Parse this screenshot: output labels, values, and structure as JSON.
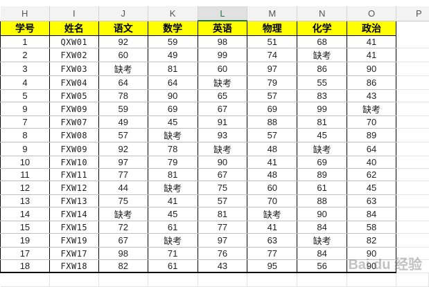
{
  "column_letters": [
    "H",
    "I",
    "J",
    "K",
    "L",
    "M",
    "N",
    "O",
    "P"
  ],
  "selected_column": "L",
  "headers": [
    "学号",
    "姓名",
    "语文",
    "数学",
    "英语",
    "物理",
    "化学",
    "政治"
  ],
  "rows": [
    [
      "1",
      "QXW01",
      "92",
      "59",
      "98",
      "51",
      "68",
      "41"
    ],
    [
      "2",
      "FXW02",
      "60",
      "49",
      "99",
      "74",
      "缺考",
      "41"
    ],
    [
      "3",
      "FXW03",
      "缺考",
      "81",
      "60",
      "97",
      "86",
      "90"
    ],
    [
      "4",
      "FXW04",
      "64",
      "64",
      "缺考",
      "79",
      "55",
      "86"
    ],
    [
      "5",
      "FXW05",
      "78",
      "90",
      "65",
      "57",
      "83",
      "43"
    ],
    [
      "9",
      "FXW09",
      "59",
      "69",
      "67",
      "69",
      "99",
      "缺考"
    ],
    [
      "7",
      "FXW07",
      "49",
      "45",
      "91",
      "88",
      "81",
      "70"
    ],
    [
      "8",
      "FXW08",
      "57",
      "缺考",
      "93",
      "57",
      "45",
      "89"
    ],
    [
      "9",
      "FXW09",
      "92",
      "78",
      "缺考",
      "48",
      "缺考",
      "64"
    ],
    [
      "10",
      "FXW10",
      "97",
      "79",
      "90",
      "41",
      "69",
      "40"
    ],
    [
      "11",
      "FXW11",
      "77",
      "81",
      "67",
      "48",
      "89",
      "62"
    ],
    [
      "12",
      "FXW12",
      "44",
      "缺考",
      "75",
      "60",
      "61",
      "45"
    ],
    [
      "13",
      "FXW13",
      "75",
      "41",
      "57",
      "70",
      "88",
      "63"
    ],
    [
      "14",
      "FXW14",
      "缺考",
      "45",
      "81",
      "缺考",
      "90",
      "84"
    ],
    [
      "15",
      "FXW15",
      "72",
      "61",
      "77",
      "41",
      "84",
      "58"
    ],
    [
      "19",
      "FXW19",
      "67",
      "缺考",
      "97",
      "63",
      "缺考",
      "82"
    ],
    [
      "17",
      "FXW17",
      "98",
      "71",
      "76",
      "77",
      "84",
      "90"
    ],
    [
      "18",
      "FXW18",
      "82",
      "61",
      "43",
      "95",
      "56",
      "90"
    ]
  ],
  "colors": {
    "header_fill": "#ffff00",
    "selected_column_accent": "#217346"
  },
  "watermark": "Bai du 经验"
}
